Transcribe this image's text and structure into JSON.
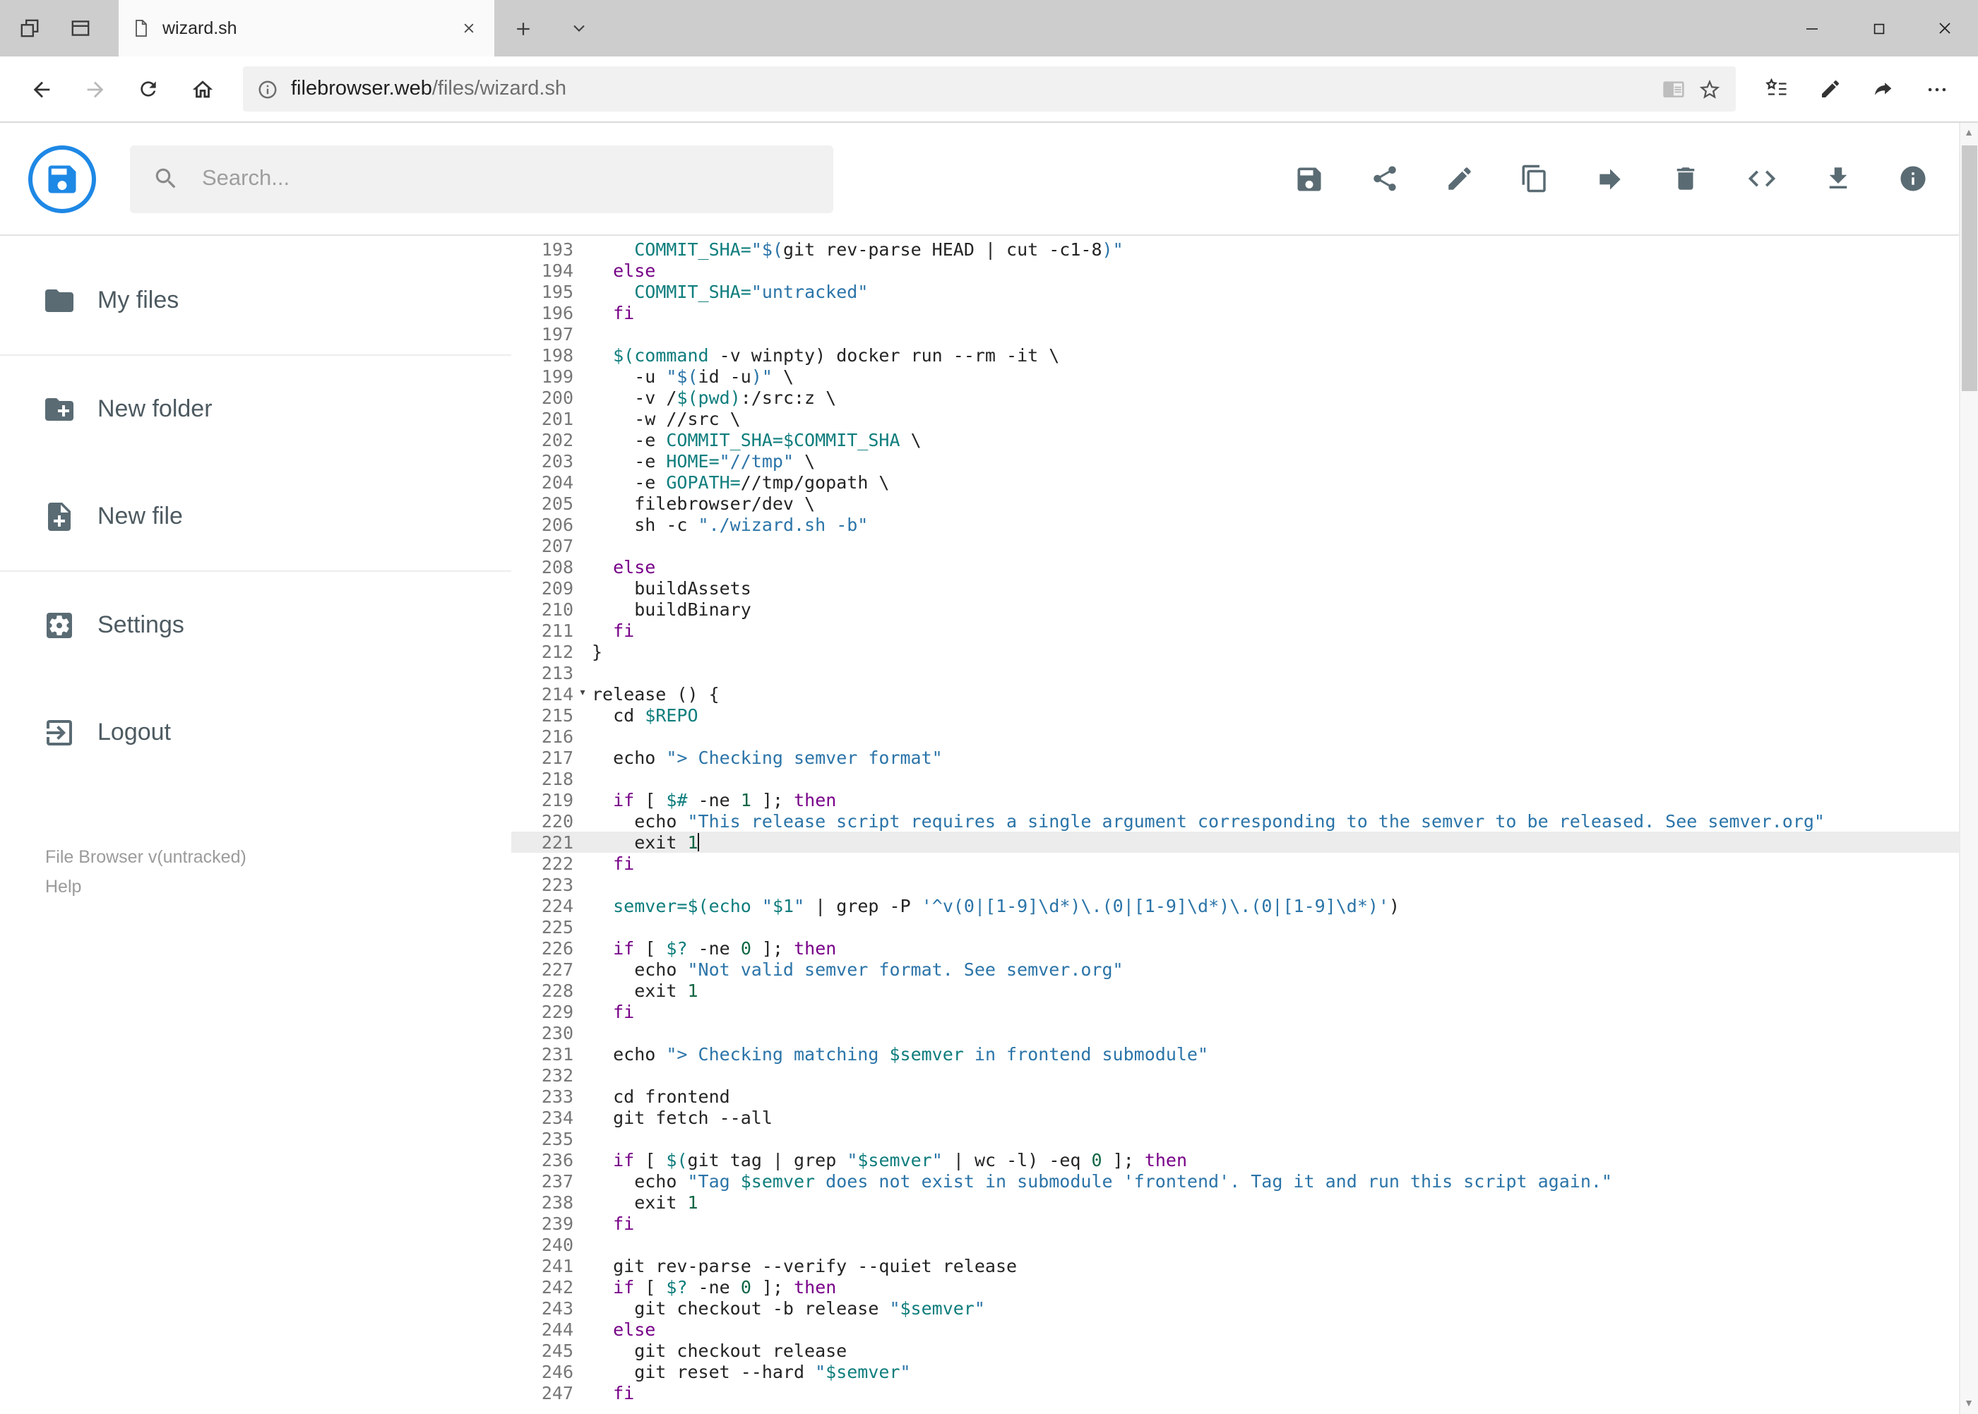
{
  "browser": {
    "tab": {
      "title": "wizard.sh"
    },
    "address": {
      "domain": "filebrowser.web",
      "path": "/files/wizard.sh"
    }
  },
  "header": {
    "search_placeholder": "Search...",
    "toolbar_buttons": [
      "save",
      "share",
      "edit",
      "copy",
      "move",
      "delete",
      "code",
      "download",
      "info"
    ]
  },
  "sidebar": {
    "items": [
      {
        "label": "My files",
        "icon": "folder-icon"
      },
      {
        "label": "New folder",
        "icon": "new-folder-icon"
      },
      {
        "label": "New file",
        "icon": "new-file-icon"
      },
      {
        "label": "Settings",
        "icon": "settings-icon"
      },
      {
        "label": "Logout",
        "icon": "logout-icon"
      }
    ],
    "credits": {
      "version": "File Browser v(untracked)",
      "help": "Help"
    }
  },
  "colors": {
    "brand_blue": "#1e88e5",
    "icon_gray": "#5a6b73",
    "keyword": "#770088",
    "string": "#2b74a8",
    "variable": "#0f7d7d",
    "number": "#116644",
    "active_line_bg": "#ececec"
  },
  "editor": {
    "active_line": 221,
    "folded_line": 214,
    "lines": [
      {
        "n": 193,
        "t": [
          [
            "p",
            "    "
          ],
          [
            "v",
            "COMMIT_SHA="
          ],
          [
            "s",
            "\"$("
          ],
          [
            "p",
            "git rev-parse HEAD | cut -c1-8"
          ],
          [
            "s",
            ")\""
          ]
        ]
      },
      {
        "n": 194,
        "t": [
          [
            "p",
            "  "
          ],
          [
            "k",
            "else"
          ]
        ]
      },
      {
        "n": 195,
        "t": [
          [
            "p",
            "    "
          ],
          [
            "v",
            "COMMIT_SHA="
          ],
          [
            "s",
            "\"untracked\""
          ]
        ]
      },
      {
        "n": 196,
        "t": [
          [
            "p",
            "  "
          ],
          [
            "k",
            "fi"
          ]
        ]
      },
      {
        "n": 197,
        "t": []
      },
      {
        "n": 198,
        "t": [
          [
            "p",
            "  "
          ],
          [
            "v",
            "$(command"
          ],
          [
            "p",
            " -v winpty) docker run --rm -it \\"
          ]
        ]
      },
      {
        "n": 199,
        "t": [
          [
            "p",
            "    -u "
          ],
          [
            "s",
            "\"$("
          ],
          [
            "p",
            "id -u"
          ],
          [
            "s",
            ")\""
          ],
          [
            "p",
            " \\"
          ]
        ]
      },
      {
        "n": 200,
        "t": [
          [
            "p",
            "    -v /"
          ],
          [
            "v",
            "$(pwd)"
          ],
          [
            "p",
            ":/src:z \\"
          ]
        ]
      },
      {
        "n": 201,
        "t": [
          [
            "p",
            "    -w //src \\"
          ]
        ]
      },
      {
        "n": 202,
        "t": [
          [
            "p",
            "    -e "
          ],
          [
            "v",
            "COMMIT_SHA=$COMMIT_SHA"
          ],
          [
            "p",
            " \\"
          ]
        ]
      },
      {
        "n": 203,
        "t": [
          [
            "p",
            "    -e "
          ],
          [
            "v",
            "HOME="
          ],
          [
            "s",
            "\"//tmp\""
          ],
          [
            "p",
            " \\"
          ]
        ]
      },
      {
        "n": 204,
        "t": [
          [
            "p",
            "    -e "
          ],
          [
            "v",
            "GOPATH="
          ],
          [
            "p",
            "//tmp/gopath \\"
          ]
        ]
      },
      {
        "n": 205,
        "t": [
          [
            "p",
            "    filebrowser/dev \\"
          ]
        ]
      },
      {
        "n": 206,
        "t": [
          [
            "p",
            "    sh -c "
          ],
          [
            "s",
            "\"./wizard.sh -b\""
          ]
        ]
      },
      {
        "n": 207,
        "t": []
      },
      {
        "n": 208,
        "t": [
          [
            "p",
            "  "
          ],
          [
            "k",
            "else"
          ]
        ]
      },
      {
        "n": 209,
        "t": [
          [
            "p",
            "    buildAssets"
          ]
        ]
      },
      {
        "n": 210,
        "t": [
          [
            "p",
            "    buildBinary"
          ]
        ]
      },
      {
        "n": 211,
        "t": [
          [
            "p",
            "  "
          ],
          [
            "k",
            "fi"
          ]
        ]
      },
      {
        "n": 212,
        "t": [
          [
            "p",
            "}"
          ]
        ]
      },
      {
        "n": 213,
        "t": []
      },
      {
        "n": 214,
        "t": [
          [
            "p",
            "release () {"
          ]
        ]
      },
      {
        "n": 215,
        "t": [
          [
            "p",
            "  cd "
          ],
          [
            "v",
            "$REPO"
          ]
        ]
      },
      {
        "n": 216,
        "t": []
      },
      {
        "n": 217,
        "t": [
          [
            "p",
            "  echo "
          ],
          [
            "s",
            "\"> Checking semver format\""
          ]
        ]
      },
      {
        "n": 218,
        "t": []
      },
      {
        "n": 219,
        "t": [
          [
            "p",
            "  "
          ],
          [
            "k",
            "if"
          ],
          [
            "p",
            " [ "
          ],
          [
            "v",
            "$#"
          ],
          [
            "p",
            " -ne "
          ],
          [
            "n2",
            "1"
          ],
          [
            "p",
            " ]; "
          ],
          [
            "k",
            "then"
          ]
        ]
      },
      {
        "n": 220,
        "t": [
          [
            "p",
            "    echo "
          ],
          [
            "s",
            "\"This release script requires a single argument corresponding to the semver to be released. See semver.org\""
          ]
        ]
      },
      {
        "n": 221,
        "t": [
          [
            "p",
            "    exit "
          ],
          [
            "n2",
            "1"
          ]
        ]
      },
      {
        "n": 222,
        "t": [
          [
            "p",
            "  "
          ],
          [
            "k",
            "fi"
          ]
        ]
      },
      {
        "n": 223,
        "t": []
      },
      {
        "n": 224,
        "t": [
          [
            "p",
            "  "
          ],
          [
            "v",
            "semver=$(echo"
          ],
          [
            "p",
            " "
          ],
          [
            "s",
            "\""
          ],
          [
            "v",
            "$1"
          ],
          [
            "s",
            "\""
          ],
          [
            "p",
            " | grep -P "
          ],
          [
            "s",
            "'^v(0|[1-9]\\d*)\\.(0|[1-9]\\d*)\\.(0|[1-9]\\d*)'"
          ],
          [
            "p",
            ")"
          ]
        ]
      },
      {
        "n": 225,
        "t": []
      },
      {
        "n": 226,
        "t": [
          [
            "p",
            "  "
          ],
          [
            "k",
            "if"
          ],
          [
            "p",
            " [ "
          ],
          [
            "v",
            "$?"
          ],
          [
            "p",
            " -ne "
          ],
          [
            "n2",
            "0"
          ],
          [
            "p",
            " ]; "
          ],
          [
            "k",
            "then"
          ]
        ]
      },
      {
        "n": 227,
        "t": [
          [
            "p",
            "    echo "
          ],
          [
            "s",
            "\"Not valid semver format. See semver.org\""
          ]
        ]
      },
      {
        "n": 228,
        "t": [
          [
            "p",
            "    exit "
          ],
          [
            "n2",
            "1"
          ]
        ]
      },
      {
        "n": 229,
        "t": [
          [
            "p",
            "  "
          ],
          [
            "k",
            "fi"
          ]
        ]
      },
      {
        "n": 230,
        "t": []
      },
      {
        "n": 231,
        "t": [
          [
            "p",
            "  echo "
          ],
          [
            "s",
            "\"> Checking matching "
          ],
          [
            "v",
            "$semver"
          ],
          [
            "s",
            " in frontend submodule\""
          ]
        ]
      },
      {
        "n": 232,
        "t": []
      },
      {
        "n": 233,
        "t": [
          [
            "p",
            "  cd frontend"
          ]
        ]
      },
      {
        "n": 234,
        "t": [
          [
            "p",
            "  git fetch --all"
          ]
        ]
      },
      {
        "n": 235,
        "t": []
      },
      {
        "n": 236,
        "t": [
          [
            "p",
            "  "
          ],
          [
            "k",
            "if"
          ],
          [
            "p",
            " [ "
          ],
          [
            "v",
            "$("
          ],
          [
            "p",
            "git tag | grep "
          ],
          [
            "s",
            "\""
          ],
          [
            "v",
            "$semver"
          ],
          [
            "s",
            "\""
          ],
          [
            "p",
            " | wc -l) -eq "
          ],
          [
            "n2",
            "0"
          ],
          [
            "p",
            " ]; "
          ],
          [
            "k",
            "then"
          ]
        ]
      },
      {
        "n": 237,
        "t": [
          [
            "p",
            "    echo "
          ],
          [
            "s",
            "\"Tag "
          ],
          [
            "v",
            "$semver"
          ],
          [
            "s",
            " does not exist in submodule 'frontend'. Tag it and run this script again.\""
          ]
        ]
      },
      {
        "n": 238,
        "t": [
          [
            "p",
            "    exit "
          ],
          [
            "n2",
            "1"
          ]
        ]
      },
      {
        "n": 239,
        "t": [
          [
            "p",
            "  "
          ],
          [
            "k",
            "fi"
          ]
        ]
      },
      {
        "n": 240,
        "t": []
      },
      {
        "n": 241,
        "t": [
          [
            "p",
            "  git rev-parse --verify --quiet release"
          ]
        ]
      },
      {
        "n": 242,
        "t": [
          [
            "p",
            "  "
          ],
          [
            "k",
            "if"
          ],
          [
            "p",
            " [ "
          ],
          [
            "v",
            "$?"
          ],
          [
            "p",
            " -ne "
          ],
          [
            "n2",
            "0"
          ],
          [
            "p",
            " ]; "
          ],
          [
            "k",
            "then"
          ]
        ]
      },
      {
        "n": 243,
        "t": [
          [
            "p",
            "    git checkout -b release "
          ],
          [
            "s",
            "\""
          ],
          [
            "v",
            "$semver"
          ],
          [
            "s",
            "\""
          ]
        ]
      },
      {
        "n": 244,
        "t": [
          [
            "p",
            "  "
          ],
          [
            "k",
            "else"
          ]
        ]
      },
      {
        "n": 245,
        "t": [
          [
            "p",
            "    git checkout release"
          ]
        ]
      },
      {
        "n": 246,
        "t": [
          [
            "p",
            "    git reset --hard "
          ],
          [
            "s",
            "\""
          ],
          [
            "v",
            "$semver"
          ],
          [
            "s",
            "\""
          ]
        ]
      },
      {
        "n": 247,
        "t": [
          [
            "p",
            "  "
          ],
          [
            "k",
            "fi"
          ]
        ]
      }
    ]
  }
}
